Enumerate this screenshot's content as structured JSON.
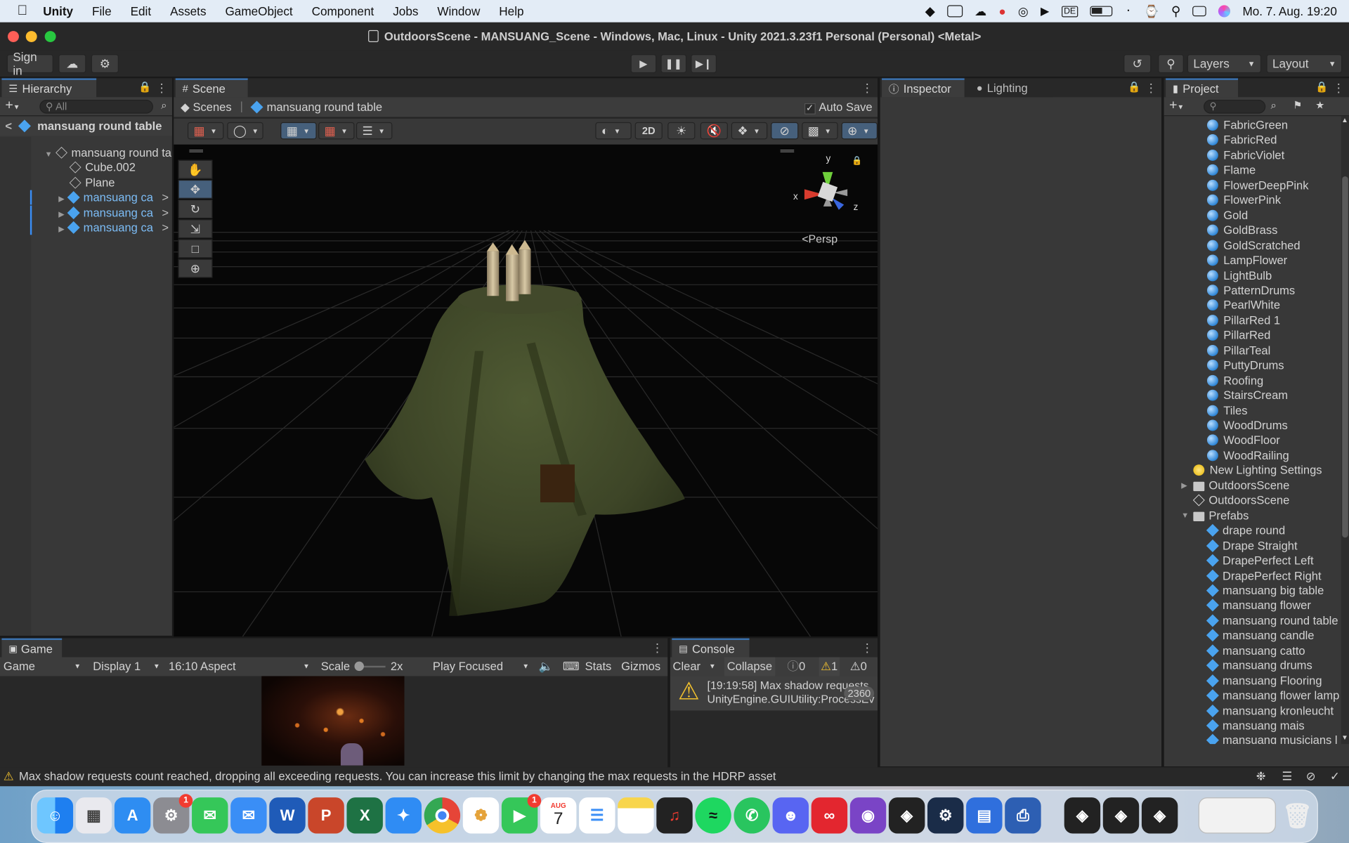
{
  "menubar": {
    "app_name": "Unity",
    "menus": [
      "File",
      "Edit",
      "Assets",
      "GameObject",
      "Component",
      "Jobs",
      "Window",
      "Help"
    ],
    "clock": "Mo. 7. Aug.  19:20"
  },
  "window": {
    "title": "OutdoorsScene - MANSUANG_Scene - Windows, Mac, Linux - Unity 2021.3.23f1 Personal (Personal) <Metal>"
  },
  "toolbar": {
    "sign_in": "Sign in",
    "layers": "Layers",
    "layout": "Layout"
  },
  "hierarchy": {
    "tab": "Hierarchy",
    "search_placeholder": "All",
    "scene_root": "mansuang  round table",
    "items": [
      {
        "label": "mansuang  round tа",
        "indent": 1,
        "type": "gameobject"
      },
      {
        "label": "Cube.002",
        "indent": 2,
        "type": "gameobject"
      },
      {
        "label": "Plane",
        "indent": 2,
        "type": "gameobject"
      },
      {
        "label": "mansuang ca",
        "indent": 2,
        "type": "prefab"
      },
      {
        "label": "mansuang ca",
        "indent": 2,
        "type": "prefab"
      },
      {
        "label": "mansuang ca",
        "indent": 2,
        "type": "prefab"
      }
    ]
  },
  "scene": {
    "tab": "Scene",
    "breadcrumb_root": "Scenes",
    "breadcrumb_item": "mansuang  round table",
    "auto_save": "Auto Save",
    "btn_2d": "2D",
    "persp": "Persp",
    "axis_x": "x",
    "axis_y": "y",
    "axis_z": "z"
  },
  "inspector": {
    "tab_inspector": "Inspector",
    "tab_lighting": "Lighting"
  },
  "project": {
    "tab": "Project",
    "items": [
      {
        "label": "FabricGreen",
        "kind": "material"
      },
      {
        "label": "FabricRed",
        "kind": "material"
      },
      {
        "label": "FabricViolet",
        "kind": "material"
      },
      {
        "label": "Flame",
        "kind": "material"
      },
      {
        "label": "FlowerDeepPink",
        "kind": "material"
      },
      {
        "label": "FlowerPink",
        "kind": "material"
      },
      {
        "label": "Gold",
        "kind": "material"
      },
      {
        "label": "GoldBrass",
        "kind": "material"
      },
      {
        "label": "GoldScratched",
        "kind": "material"
      },
      {
        "label": "LampFlower",
        "kind": "material"
      },
      {
        "label": "LightBulb",
        "kind": "material"
      },
      {
        "label": "PatternDrums",
        "kind": "material"
      },
      {
        "label": "PearlWhite",
        "kind": "material"
      },
      {
        "label": "PillarRed 1",
        "kind": "material"
      },
      {
        "label": "PillarRed",
        "kind": "material"
      },
      {
        "label": "PillarTeal",
        "kind": "material"
      },
      {
        "label": "PuttyDrums",
        "kind": "material"
      },
      {
        "label": "Roofing",
        "kind": "material"
      },
      {
        "label": "StairsCream",
        "kind": "material"
      },
      {
        "label": "Tiles",
        "kind": "material"
      },
      {
        "label": "WoodDrums",
        "kind": "material"
      },
      {
        "label": "WoodFloor",
        "kind": "material"
      },
      {
        "label": "WoodRailing",
        "kind": "material"
      },
      {
        "label": "New Lighting Settings",
        "kind": "lighting"
      },
      {
        "label": "OutdoorsScene",
        "kind": "folder"
      },
      {
        "label": "OutdoorsScene",
        "kind": "scene"
      },
      {
        "label": "Prefabs",
        "kind": "folder-open"
      },
      {
        "label": "drape round",
        "kind": "prefab"
      },
      {
        "label": "Drape Straight",
        "kind": "prefab"
      },
      {
        "label": "DrapePerfect Left",
        "kind": "prefab"
      },
      {
        "label": "DrapePerfect Right",
        "kind": "prefab"
      },
      {
        "label": "mansuang  big table",
        "kind": "prefab"
      },
      {
        "label": "mansuang  flower",
        "kind": "prefab"
      },
      {
        "label": "mansuang  round table",
        "kind": "prefab"
      },
      {
        "label": "mansuang candle",
        "kind": "prefab"
      },
      {
        "label": "mansuang catto",
        "kind": "prefab"
      },
      {
        "label": "mansuang drums",
        "kind": "prefab"
      },
      {
        "label": "mansuang Flooring",
        "kind": "prefab"
      },
      {
        "label": "mansuang flower lamp",
        "kind": "prefab"
      },
      {
        "label": "mansuang kronleucht",
        "kind": "prefab"
      },
      {
        "label": "mansuang mais",
        "kind": "prefab"
      },
      {
        "label": "mansuang musicians l",
        "kind": "prefab"
      }
    ]
  },
  "game": {
    "tab": "Game",
    "mode": "Game",
    "display": "Display 1",
    "aspect": "16:10 Aspect",
    "scale_label": "Scale",
    "scale_value": "2x",
    "play_focused": "Play Focused",
    "stats": "Stats",
    "gizmos": "Gizmos"
  },
  "console": {
    "tab": "Console",
    "clear": "Clear",
    "collapse": "Collapse",
    "info_count": "0",
    "warn_count": "1",
    "error_count": "0",
    "message_line1": "[19:19:58] Max shadow requests",
    "message_line2": "UnityEngine.GUIUtility:ProcessEv",
    "message_count": "2360"
  },
  "statusbar": {
    "message": "Max shadow requests count reached, dropping all exceeding requests. You can increase this limit by changing the max requests in the HDRP asset"
  },
  "dock": {
    "calendar_month": "AUG",
    "calendar_day": "7",
    "badge_settings": "1",
    "badge_facetime": "1",
    "apps": [
      "finder-icon",
      "launchpad-icon",
      "app-store-icon",
      "system-settings-icon",
      "messages-icon",
      "mail-icon",
      "word-icon",
      "powerpoint-icon",
      "excel-icon",
      "safari-icon",
      "chrome-icon",
      "photos-icon",
      "facetime-icon",
      "calendar-icon",
      "reminders-icon",
      "notes-icon",
      "voice-memos-icon",
      "spotify-icon",
      "whatsapp-icon",
      "discord-icon",
      "creative-cloud-icon",
      "github-desktop-icon",
      "unity-hub-icon",
      "steam-icon",
      "keynote-icon",
      "printer-icon",
      "unity-icon",
      "unity-icon",
      "unity-icon",
      "downloads-stack-icon",
      "trash-icon"
    ]
  }
}
